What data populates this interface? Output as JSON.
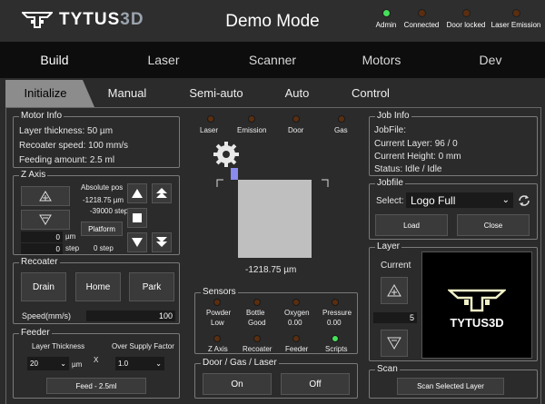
{
  "header": {
    "brand_a": "TYTUS",
    "brand_b": "3D",
    "mode": "Demo Mode",
    "status": [
      {
        "label": "Admin",
        "on": true
      },
      {
        "label": "Connected",
        "on": false
      },
      {
        "label": "Door locked",
        "on": false
      },
      {
        "label": "Laser Emission",
        "on": false
      }
    ]
  },
  "nav": [
    "Build",
    "Laser",
    "Scanner",
    "Motors",
    "Dev"
  ],
  "tabs": [
    "Initialize",
    "Manual",
    "Semi-auto",
    "Auto",
    "Control"
  ],
  "motor": {
    "title": "Motor Info",
    "layer": "Layer thickness: 50 µm",
    "speed": "Recoater speed: 100 mm/s",
    "feed": "Feeding amount: 2.5 ml"
  },
  "zaxis": {
    "title": "Z Axis",
    "abs_label": "Absolute pos",
    "abs_um": "-1218.75 µm",
    "abs_step": "-39000 step",
    "platform": "Platform",
    "um_val": "0",
    "um_unit": "µm",
    "step_val": "0",
    "step_unit": "step",
    "step_right": "0 step"
  },
  "recoater": {
    "title": "Recoater",
    "drain": "Drain",
    "home": "Home",
    "park": "Park",
    "speed_label": "Speed(mm/s)",
    "speed_val": "100"
  },
  "feeder": {
    "title": "Feeder",
    "lt_label": "Layer Thickness",
    "os_label": "Over Supply Factor",
    "lt_val": "20",
    "lt_unit": "µm",
    "x": "X",
    "os_val": "1.0",
    "feed_btn": "Feed - 2.5ml"
  },
  "indicators": [
    {
      "label": "Laser"
    },
    {
      "label": "Emission"
    },
    {
      "label": "Door"
    },
    {
      "label": "Gas"
    }
  ],
  "platform_pos": "-1218.75 µm",
  "sensors": {
    "title": "Sensors",
    "row1": [
      {
        "name": "Powder",
        "val": "Low"
      },
      {
        "name": "Bottle",
        "val": "Good"
      },
      {
        "name": "Oxygen",
        "val": "0.00"
      },
      {
        "name": "Pressure",
        "val": "0.00"
      }
    ],
    "row2": [
      {
        "name": "Z Axis",
        "on": false
      },
      {
        "name": "Recoater",
        "on": false
      },
      {
        "name": "Feeder",
        "on": false
      },
      {
        "name": "Scripts",
        "on": true
      }
    ]
  },
  "door": {
    "title": "Door / Gas / Laser",
    "on": "On",
    "off": "Off"
  },
  "job": {
    "title": "Job Info",
    "file": "JobFile:",
    "layer": "Current Layer:  96  /  0",
    "height": "Current Height:  0 mm",
    "status": "Status:  Idle / Idle"
  },
  "jobfile": {
    "title": "Jobfile",
    "select_label": "Select:",
    "select_val": "Logo Full",
    "load": "Load",
    "close": "Close"
  },
  "layer": {
    "title": "Layer",
    "current": "Current",
    "val": "5",
    "preview_text": "TYTUS3D"
  },
  "scan": {
    "title": "Scan",
    "btn": "Scan Selected Layer"
  },
  "colors": {
    "accent": "#45e05a",
    "logo_preview": "#f2f2c8"
  }
}
